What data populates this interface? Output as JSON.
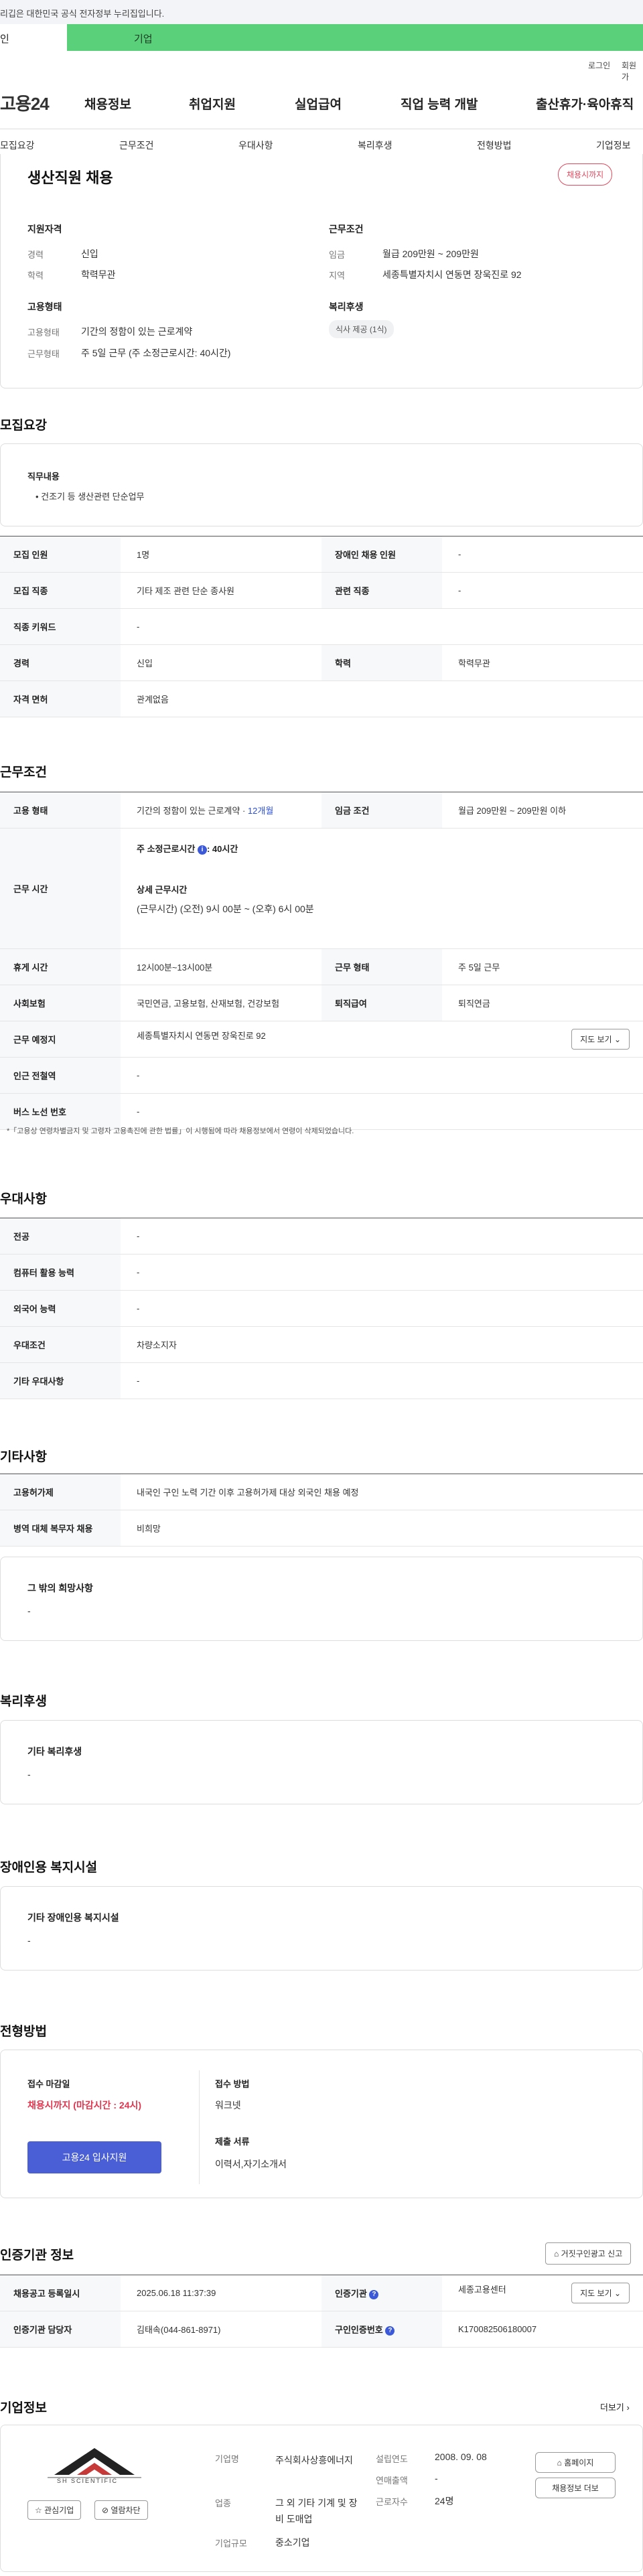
{
  "notice": "리깁은 대한민국 공식 전자정부 누리집입니다.",
  "tabs": {
    "individual": "인",
    "corporate": "기업"
  },
  "util": {
    "login": "로그인",
    "join": "회원가"
  },
  "logo": "고용24",
  "gnb": [
    "채용정보",
    "취업지원",
    "실업급여",
    "직업 능력 개발",
    "출산휴가·육아휴직"
  ],
  "anchors": [
    "모집요강",
    "근무조건",
    "우대사항",
    "복리후생",
    "전형방법",
    "기업정보"
  ],
  "summary": {
    "title": "생산직원 채용",
    "status_badge": "채용시까지",
    "qual_title": "지원자격",
    "career_label": "경력",
    "career_value": "신입",
    "edu_label": "학력",
    "edu_value": "학력무관",
    "work_title": "근무조건",
    "wage_label": "임금",
    "wage_value": "월급 209만원 ~ 209만원",
    "region_label": "지역",
    "region_value": "세종특별자치시 연동면 장욱진로 92",
    "emp_title": "고용형태",
    "emptype_label": "고용형태",
    "emptype_value": "기간의 정함이 있는 근로계약",
    "worktype_label": "근무형태",
    "worktype_value": "주 5일 근무 (주 소정근로시간: 40시간)",
    "welfare_title": "복리후생",
    "welfare_pill": "식사 제공 (1식)"
  },
  "recruit": {
    "section": "모집요강",
    "duty_title": "직무내용",
    "duty_item": "• 건조기 등 생산관련 단순업무",
    "rows": [
      [
        "모집 인원",
        "1명",
        "장애인 채용 인원",
        "-"
      ],
      [
        "모집 직종",
        "기타 제조 관련 단순 종사원",
        "관련 직종",
        "-"
      ],
      [
        "직종 키워드",
        "-"
      ],
      [
        "경력",
        "신입",
        "학력",
        "학력무관"
      ],
      [
        "자격 면허",
        "관계없음"
      ]
    ]
  },
  "conditions": {
    "section": "근무조건",
    "emp_label": "고용 형태",
    "emp_value": "기간의 정함이 있는 근로계약 · ",
    "emp_months": "12개월",
    "wage_label": "임금 조건",
    "wage_value": "월급 209만원 ~ 209만원 이하",
    "time_label": "근무 시간",
    "time_std": "주 소정근로시간",
    "time_std_value": ": 40시간",
    "time_detail_title": "상세 근무시간",
    "time_detail": "(근무시간) (오전) 9시 00분 ~ (오후) 6시 00분",
    "rest_label": "휴게 시간",
    "rest_value": "12시00분~13시00분",
    "worktype_label": "근무 형태",
    "worktype_value": "주 5일 근무",
    "insurance_label": "사회보험",
    "insurance_value": "국민연금, 고용보험, 산재보험, 건강보험",
    "retire_label": "퇴직급여",
    "retire_value": "퇴직연금",
    "place_label": "근무 예정지",
    "place_value": "세종특별자치시 연동면 장욱진로 92",
    "map_button": "지도 보기",
    "subway_label": "인근 전철역",
    "subway_value": "-",
    "bus_label": "버스 노선 번호",
    "bus_value": "-",
    "footnote": "*「고용상 연령차별금지 및 고령자 고용촉진에 관한 법률」이 시행됨에 따라 채용정보에서 연령이 삭제되었습니다."
  },
  "prefer": {
    "section": "우대사항",
    "rows": [
      [
        "전공",
        "-"
      ],
      [
        "컴퓨터 활용 능력",
        "-"
      ],
      [
        "외국어 능력",
        "-"
      ],
      [
        "우대조건",
        "차량소지자"
      ],
      [
        "기타 우대사항",
        "-"
      ]
    ]
  },
  "etc": {
    "section": "기타사항",
    "rows": [
      [
        "고용허가제",
        "내국인 구인 노력 기간 이후 고용허가제 대상 외국인 채용 예정"
      ],
      [
        "병역 대체 복무자 채용",
        "비희망"
      ]
    ],
    "other_title": "그 밖의 희망사항",
    "other_value": "-"
  },
  "welfare": {
    "section": "복리후생",
    "title": "기타 복리후생",
    "value": "-"
  },
  "disabled": {
    "section": "장애인용 복지시설",
    "title": "기타 장애인용 복지시설",
    "value": "-"
  },
  "screening": {
    "section": "전형방법",
    "deadline_title": "접수 마감일",
    "deadline_value": "채용시까지 (마감시간 : 24시)",
    "apply_button": "고용24 입사지원",
    "method_title": "접수 방법",
    "method_value": "워크넷",
    "docs_title": "제출 서류",
    "docs_value": "이력서,자기소개서"
  },
  "agency": {
    "section": "인증기관 정보",
    "report_button": "거짓구인광고 신고",
    "reg_label": "채용공고 등록일시",
    "reg_value": "2025.06.18 11:37:39",
    "org_label": "인증기관",
    "org_value": "세종고용센터",
    "map_button": "지도 보기",
    "staff_label": "인증기관 담당자",
    "staff_value": "김태속(044-861-8971)",
    "cert_label": "구인인증번호",
    "cert_value": "K170082506180007"
  },
  "company": {
    "section": "기업정보",
    "more": "더보기",
    "logo_text": "SH SCIENTIFIC",
    "interest_button": "관심기업",
    "block_button": "열람차단",
    "name_label": "기업명",
    "name_value": "주식회사상흥에너지",
    "industry_label": "업종",
    "industry_value": "그 외 기타 기계 및 장비 도매업",
    "size_label": "기업규모",
    "size_value": "중소기업",
    "founded_label": "설립연도",
    "founded_value": "2008. 09. 08",
    "sales_label": "연매출액",
    "sales_value": "-",
    "staff_label": "근로자수",
    "staff_value": "24명",
    "homepage_button": "홈페이지",
    "jobs_button": "채용정보 더보"
  }
}
